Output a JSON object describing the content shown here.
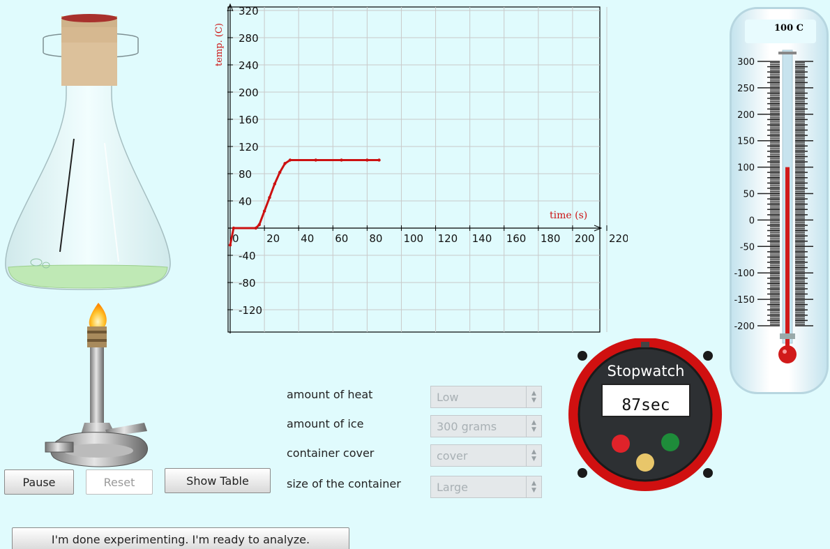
{
  "controls": {
    "pause_label": "Pause",
    "reset_label": "Reset",
    "show_table_label": "Show Table",
    "done_label": "I'm done experimenting. I'm ready to analyze.",
    "heat_label": "amount of heat",
    "heat_value": "Low",
    "ice_label": "amount of ice",
    "ice_value": "300 grams",
    "cover_label": "container cover",
    "cover_value": "cover",
    "size_label": "size of the container",
    "size_value": "Large"
  },
  "stopwatch": {
    "title": "Stopwatch",
    "display": "87sec"
  },
  "thermometer": {
    "reading": "100 C",
    "value": 100,
    "scale_labels": [
      "300",
      "250",
      "200",
      "150",
      "100",
      "50",
      "0",
      "-50",
      "-100",
      "-150",
      "-200"
    ]
  },
  "colors": {
    "background": "#e0fbfd",
    "graph_line": "#cc1111",
    "stopwatch_ring": "#d01010",
    "stopwatch_red": "#e0232a",
    "stopwatch_green": "#1e8c3a",
    "stopwatch_yellow": "#e8c66a"
  },
  "icons": [
    "erlenmeyer-flask-icon",
    "bunsen-burner-icon",
    "flame-icon",
    "thermometer-icon",
    "stopwatch-icon"
  ],
  "chart_data": {
    "type": "line",
    "title": "",
    "xlabel": "time (s)",
    "ylabel": "temp. (C)",
    "xlim": [
      0,
      220
    ],
    "ylim": [
      -140,
      320
    ],
    "x_ticks": [
      0,
      20,
      40,
      60,
      80,
      100,
      120,
      140,
      160,
      180,
      200,
      220
    ],
    "y_ticks": [
      -120,
      -80,
      -40,
      40,
      80,
      120,
      160,
      200,
      240,
      280,
      320
    ],
    "grid": true,
    "series": [
      {
        "x": [
          0,
          2,
          15,
          17,
          20,
          23,
          26,
          29,
          32,
          35,
          50,
          65,
          80,
          87
        ],
        "y": [
          -25,
          0,
          0,
          5,
          25,
          45,
          65,
          82,
          95,
          100,
          100,
          100,
          100,
          100
        ]
      }
    ]
  }
}
